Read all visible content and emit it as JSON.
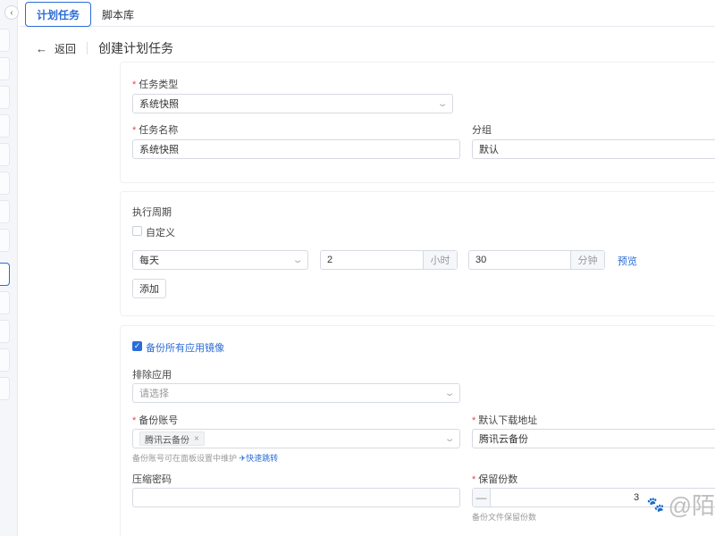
{
  "sidebar": {
    "collapse_icon": "chevron-left-icon",
    "collapse_glyph": "‹"
  },
  "tabs": [
    {
      "label": "计划任务"
    },
    {
      "label": "脚本库"
    }
  ],
  "header": {
    "back_label": "返回",
    "back_icon": "arrow-left-icon",
    "arrow_glyph": "←",
    "title": "创建计划任务"
  },
  "required_mark": "*",
  "basic": {
    "task_type": {
      "label": "任务类型",
      "value": "系统快照"
    },
    "task_name": {
      "label": "任务名称",
      "value": "系统快照"
    },
    "group": {
      "label": "分组",
      "value": "默认"
    }
  },
  "schedule": {
    "label": "执行周期",
    "custom_label": "自定义",
    "custom_checked": false,
    "period_value": "每天",
    "hour_value": "2",
    "hour_unit": "小时",
    "minute_value": "30",
    "minute_unit": "分钟",
    "preview_label": "预览",
    "add_label": "添加"
  },
  "backup": {
    "backup_all_label": "备份所有应用镜像",
    "backup_all_checked": true,
    "exclude": {
      "label": "排除应用",
      "placeholder": "请选择"
    },
    "account": {
      "label": "备份账号",
      "tag": "腾讯云备份",
      "tag_close": "×",
      "hint": "备份账号可在面板设置中维护",
      "quick_link": "快速跳转",
      "quick_icon": "send-icon",
      "quick_glyph": "✈"
    },
    "download": {
      "label": "默认下载地址",
      "value": "腾讯云备份"
    },
    "password": {
      "label": "压缩密码",
      "value": ""
    },
    "retain": {
      "label": "保留份数",
      "minus": "—",
      "value": "3",
      "hint": "备份文件保留份数"
    }
  },
  "check_glyph": "✓",
  "chevron_glyph": "⌄",
  "watermark": {
    "text": "@陌",
    "icon": "paw-icon",
    "glyph": "🐾"
  }
}
